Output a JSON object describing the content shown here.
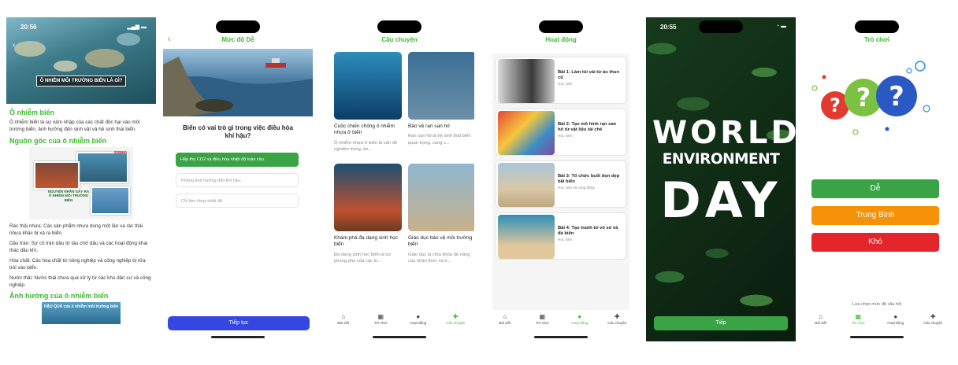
{
  "screen1": {
    "time": "20:56",
    "banner": "Ô NHIỄM MÔI TRƯỜNG BIỂN LÀ GÌ?",
    "h1": "Ô nhiễm biển",
    "p1": "Ô nhiễm biển là sự xâm nhập của các chất độc hại vào môi trường biển, ảnh hưởng đến sinh vật và hệ sinh thái biển.",
    "h2": "Nguồn gốc của ô nhiễm biển",
    "info_brand": "SONHA",
    "info_caption": "NGUYÊN NHÂN GÂY RA Ô NHIỄM MÔI TRƯỜNG BIỂN",
    "p2": "Rác thải nhựa: Các sản phẩm nhựa dùng một lần và rác thải nhựa khác bị xả ra biển.",
    "p3": "Dầu tràn: Sự cố tràn dầu từ tàu chở dầu và các hoạt động khai thác dầu khí.",
    "p4": "Hóa chất: Các hóa chất từ nông nghiệp và công nghiệp bị rửa trôi vào biển.",
    "p5": "Nước thải: Nước thải chưa qua xử lý từ các khu dân cư và công nghiệp.",
    "h3": "Ảnh hưởng của ô nhiễm biển",
    "img2_caption": "HẬU QUẢ của ô nhiễm môi trường biển"
  },
  "screen2": {
    "title": "Mức độ Dễ",
    "question": "Biển có vai trò gì trong việc điều hòa khí hậu?",
    "options": [
      "Hấp thụ CO2 và điều hòa nhiệt độ toàn cầu.",
      "Không ảnh hưởng đến khí hậu.",
      "Chỉ làm tăng nhiệt độ."
    ],
    "button": "Tiếp tục"
  },
  "screen3": {
    "title": "Câu chuyện",
    "cards": [
      {
        "title": "Cuộc chiến chống ô nhiễm nhựa ở biển",
        "desc": "Ô nhiễm nhựa ở biển là vấn đề nghiêm trọng, ản..."
      },
      {
        "title": "Bảo vệ rạn san hô",
        "desc": "Rạn san hô là hệ sinh thái biển quan trọng, cung c..."
      },
      {
        "title": "Khám phá đa dạng sinh học biển",
        "desc": "Đa dạng sinh học biển là sự phong phú của các lo..."
      },
      {
        "title": "Giáo dục bảo vệ môi trường biển",
        "desc": "Giáo dục là chìa khóa để nâng cao nhận thức và h..."
      }
    ]
  },
  "screen4": {
    "title": "Hoạt động",
    "items": [
      {
        "title": "Bài 1: Làm túi vải từ áo thun cũ",
        "sub": "Học sinh"
      },
      {
        "title": "Bài 2: Tạo mô hình rạn san hô từ vật liệu tái chế",
        "sub": "Học sinh"
      },
      {
        "title": "Bài 3: Tổ chức buổi dọn dẹp bãi biển",
        "sub": "Học sinh và cộng đồng"
      },
      {
        "title": "Bài 4: Tạo tranh từ vỏ sò và đá biển",
        "sub": "Học sinh"
      }
    ]
  },
  "screen5": {
    "time": "20:55",
    "line1": "WORLD",
    "line2": "ENVIRONMENT",
    "line3": "DAY",
    "button": "Tiếp"
  },
  "screen6": {
    "title": "Trò chơi",
    "levels": [
      "Dễ",
      "Trung Bình",
      "Khó"
    ],
    "level_colors": [
      "#3aa345",
      "#f5920a",
      "#e5252c"
    ],
    "hint": "Lựa chọn mức độ câu hỏi"
  },
  "tabs": [
    "Bài viết",
    "Trò chơi",
    "Hoạt động",
    "Câu chuyện"
  ],
  "tab_icons": [
    "home-icon",
    "grid-icon",
    "info-icon",
    "puzzle-icon"
  ],
  "accent": "#3cba2c"
}
